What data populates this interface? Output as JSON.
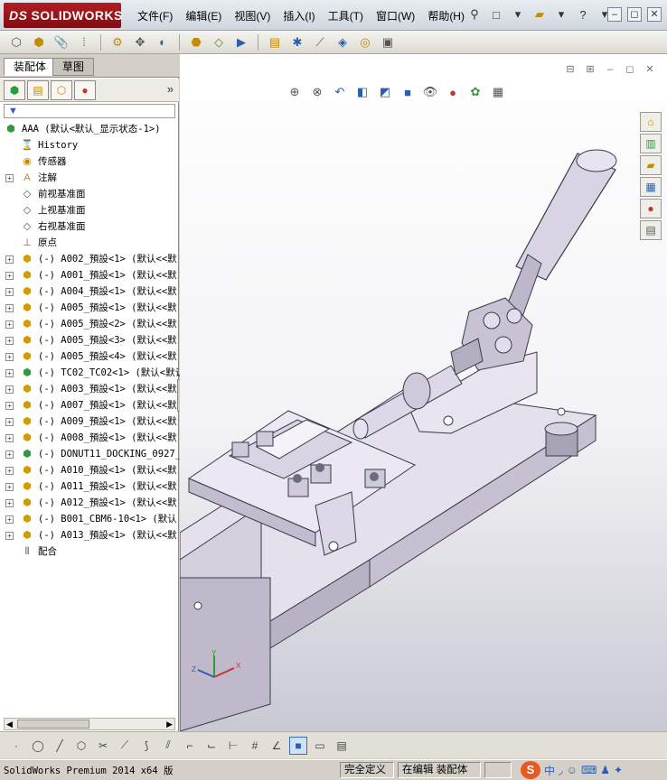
{
  "app": {
    "logo_text": "SOLIDWORKS",
    "logo_mark": "DS"
  },
  "menu": [
    "文件(F)",
    "编辑(E)",
    "视图(V)",
    "插入(I)",
    "工具(T)",
    "窗口(W)",
    "帮助(H)"
  ],
  "left_panel": {
    "tabs": [
      "装配体",
      "草图"
    ],
    "root": "AAA  (默认<默认_显示状态-1>)",
    "nodes": [
      {
        "label": "History",
        "icon": "history-icon",
        "expand": false
      },
      {
        "label": "传感器",
        "icon": "sensor-icon",
        "expand": false
      },
      {
        "label": "注解",
        "icon": "annotation-icon",
        "expand": true
      },
      {
        "label": "前视基准面",
        "icon": "plane-icon",
        "expand": false
      },
      {
        "label": "上视基准面",
        "icon": "plane-icon",
        "expand": false
      },
      {
        "label": "右视基准面",
        "icon": "plane-icon",
        "expand": false
      },
      {
        "label": "原点",
        "icon": "origin-icon",
        "expand": false
      },
      {
        "label": "(-) A002_預設<1> (默认<<默",
        "icon": "part-icon",
        "expand": true
      },
      {
        "label": "(-) A001_預設<1> (默认<<默",
        "icon": "part-icon",
        "expand": true
      },
      {
        "label": "(-) A004_預設<1> (默认<<默",
        "icon": "part-icon",
        "expand": true
      },
      {
        "label": "(-) A005_預設<1> (默认<<默",
        "icon": "part-icon",
        "expand": true
      },
      {
        "label": "(-) A005_預設<2> (默认<<默",
        "icon": "part-icon",
        "expand": true
      },
      {
        "label": "(-) A005_預設<3> (默认<<默",
        "icon": "part-icon",
        "expand": true
      },
      {
        "label": "(-) A005_預設<4> (默认<<默",
        "icon": "part-icon",
        "expand": true
      },
      {
        "label": "(-) TC02_TC02<1> (默认<默认",
        "icon": "assembly-icon",
        "expand": true
      },
      {
        "label": "(-) A003_預設<1> (默认<<默",
        "icon": "part-icon",
        "expand": true
      },
      {
        "label": "(-) A007_預設<1> (默认<<默",
        "icon": "part-icon",
        "expand": true
      },
      {
        "label": "(-) A009_預設<1> (默认<<默",
        "icon": "part-icon",
        "expand": true
      },
      {
        "label": "(-) A008_預設<1> (默认<<默",
        "icon": "part-icon",
        "expand": true
      },
      {
        "label": "(-) DONUT11_DOCKING_0927_A",
        "icon": "assembly-icon",
        "expand": true
      },
      {
        "label": "(-) A010_預設<1> (默认<<默",
        "icon": "part-icon",
        "expand": true
      },
      {
        "label": "(-) A011_預設<1> (默认<<默",
        "icon": "part-icon",
        "expand": true
      },
      {
        "label": "(-) A012_預設<1> (默认<<默",
        "icon": "part-icon",
        "expand": true
      },
      {
        "label": "(-) B001_CBM6-10<1> (默认",
        "icon": "part-icon",
        "expand": true
      },
      {
        "label": "(-) A013_預設<1> (默认<<默",
        "icon": "part-icon",
        "expand": true
      },
      {
        "label": "配合",
        "icon": "mates-icon",
        "expand": false
      }
    ]
  },
  "status": {
    "product": "SolidWorks Premium 2014 x64 版",
    "definition": "完全定义",
    "editing": "在编辑 装配体"
  },
  "ime": {
    "logo": "S",
    "lang": "中"
  },
  "colors": {
    "brand_red": "#b31c23",
    "viewport_bg": "#f3f3f6",
    "model_face": "#e6e2ee"
  }
}
